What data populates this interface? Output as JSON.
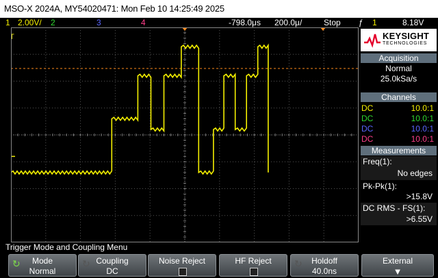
{
  "title": "MSO-X 2024A, MY54020471: Mon Feb 10 14:25:49 2025",
  "status": {
    "ch1_num": "1",
    "ch1_scale": "2.00V/",
    "ch2_num": "2",
    "ch3_num": "3",
    "ch4_num": "4",
    "delay": "-798.0μs",
    "timebase": "200.0μ/",
    "run_state": "Stop",
    "trig_icon": "ƒ",
    "trig_ch": "1",
    "trig_level": "8.18V"
  },
  "colors": {
    "ch1": "#f5f000",
    "ch2": "#2fd72f",
    "ch3": "#5a66ff",
    "ch4": "#ff3f8a",
    "trigger": "#ff8a1a",
    "grid": "#555555"
  },
  "markers": {
    "trigger_label": "T",
    "ground_label": "1"
  },
  "waveform": {
    "channel": "1",
    "x_range": [
      -0.001798,
      0.000202
    ],
    "y_range": [
      -8.0,
      12.0
    ],
    "trigger_time": -0.000798,
    "trigger_level": 8.18,
    "levels_volts": [
      -1.5,
      3.5,
      7.5,
      2.5,
      7.5,
      10.2,
      -1.5,
      2.5,
      7.5,
      2.5,
      7.5,
      10.2,
      -1.5
    ],
    "segment_times": [
      -0.001798,
      -0.001218,
      -0.001068,
      -0.000993,
      -0.000918,
      -0.000818,
      -0.000718,
      -0.000633,
      -0.000573,
      -0.000508,
      -0.000443,
      -0.000378,
      -0.000318,
      -0.000318
    ]
  },
  "panel": {
    "brand": "KEYSIGHT",
    "brand_sub": "TECHNOLOGIES",
    "acq_header": "Acquisition",
    "acq_mode": "Normal",
    "acq_rate": "25.0kSa/s",
    "channels_header": "Channels",
    "channels": [
      {
        "coupling": "DC",
        "probe": "10.0:1"
      },
      {
        "coupling": "DC",
        "probe": "10.0:1"
      },
      {
        "coupling": "DC",
        "probe": "10.0:1"
      },
      {
        "coupling": "DC",
        "probe": "10.0:1"
      }
    ],
    "meas_header": "Measurements",
    "measurements": [
      {
        "label": "Freq(1):",
        "value": "No edges"
      },
      {
        "label": "Pk-Pk(1):",
        "value": ">15.8V"
      },
      {
        "label": "DC RMS - FS(1):",
        "value": ">6.55V"
      }
    ]
  },
  "menu": {
    "title": "Trigger Mode and Coupling Menu",
    "keys": [
      {
        "top": "Mode",
        "bottom": "Normal"
      },
      {
        "top": "Coupling",
        "bottom": "DC"
      },
      {
        "top": "Noise Reject",
        "bottom": ""
      },
      {
        "top": "HF Reject",
        "bottom": ""
      },
      {
        "top": "Holdoff",
        "bottom": "40.0ns"
      },
      {
        "top": "External",
        "bottom": ""
      }
    ]
  }
}
